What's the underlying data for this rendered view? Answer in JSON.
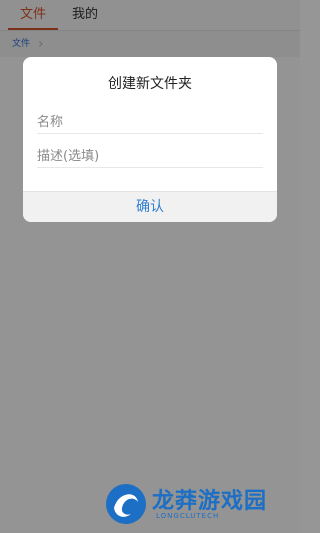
{
  "tabs": [
    {
      "label": "文件",
      "active": true
    },
    {
      "label": "我的",
      "active": false
    }
  ],
  "breadcrumb": {
    "label": "文件"
  },
  "dialog": {
    "title": "创建新文件夹",
    "name_placeholder": "名称",
    "desc_placeholder": "描述(选填)",
    "confirm_label": "确认"
  },
  "watermark": {
    "title": "龙莽游戏园",
    "subtitle": "LONGCLUTECH"
  },
  "colors": {
    "accent_tab": "#d8542c",
    "link_blue": "#2f7fd0",
    "overlay": "#969696"
  }
}
